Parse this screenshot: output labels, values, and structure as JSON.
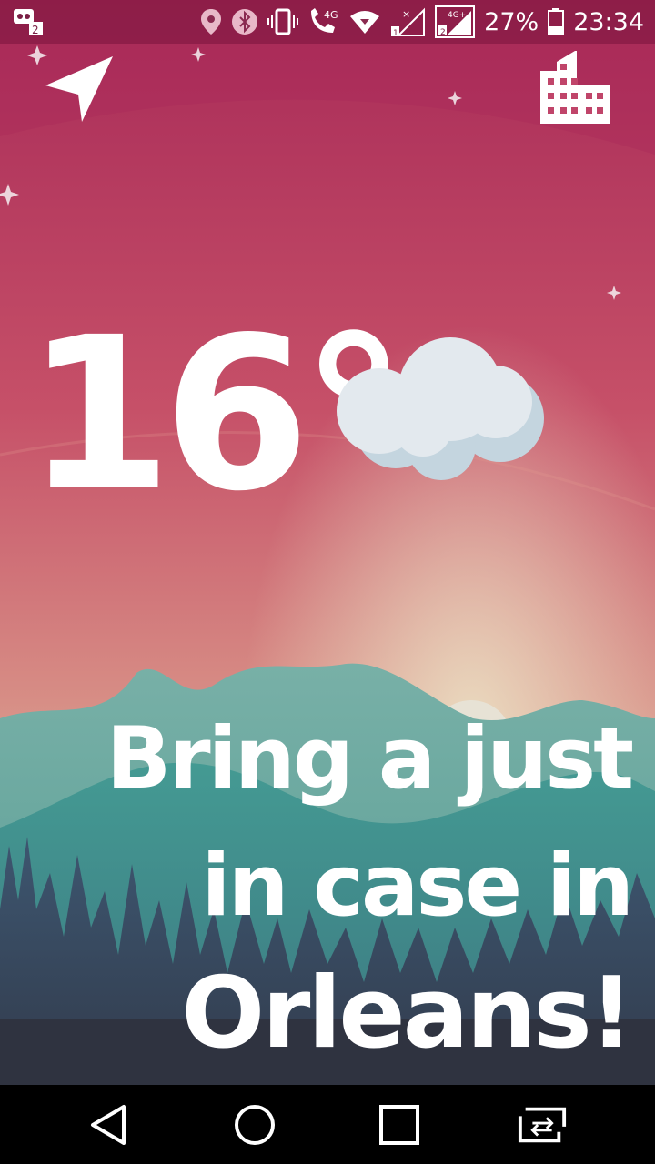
{
  "status_bar": {
    "battery_percent": "27%",
    "time": "23:34",
    "network_label_1": "4G",
    "network_label_2": "4G+",
    "sim1": "1",
    "sim2": "2",
    "notification_badge": "2"
  },
  "weather": {
    "temperature": "16°",
    "condition_icon": "cloud-icon"
  },
  "message": {
    "line1": "Bring a   just",
    "line2": "in case in",
    "line3": "Orleans!"
  },
  "colors": {
    "sky_top": "#b5335f",
    "sky_mid": "#c9617a",
    "horizon": "#d9c7b0",
    "hill_far": "#6ba7a0",
    "hill_near": "#3f8f89",
    "forest": "#35424f",
    "ground": "#2f3340"
  },
  "icons": {
    "top_left": "location-arrow-icon",
    "top_right": "city-buildings-icon"
  },
  "navbar": {
    "back": "back-triangle-icon",
    "home": "home-circle-icon",
    "recents": "recents-square-icon",
    "switch": "switch-apps-icon"
  }
}
